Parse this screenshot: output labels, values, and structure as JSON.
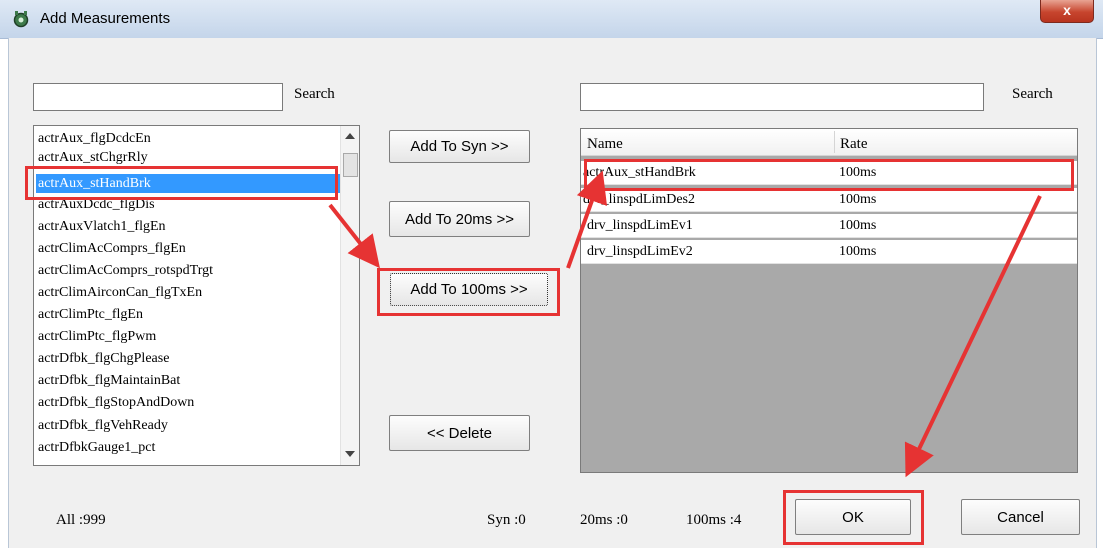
{
  "window": {
    "title": "Add Measurements",
    "close_glyph": "x",
    "icon": "app-gear-icon"
  },
  "left": {
    "search_value": "",
    "search_label": "Search",
    "items": [
      "actrAux_flgDcdcEn",
      "actrAux_stChgrRly",
      "actrAux_stHandBrk",
      "actrAuxDcdc_flgDis",
      "actrAuxVlatch1_flgEn",
      "actrClimAcComprs_flgEn",
      "actrClimAcComprs_rotspdTrgt",
      "actrClimAirconCan_flgTxEn",
      "actrClimPtc_flgEn",
      "actrClimPtc_flgPwm",
      "actrDfbk_flgChgPlease",
      "actrDfbk_flgMaintainBat",
      "actrDfbk_flgStopAndDown",
      "actrDfbk_flgVehReady",
      "actrDfbkGauge1_pct"
    ],
    "selected_index": 2
  },
  "buttons": {
    "add_syn": "Add To Syn >>",
    "add_20ms": "Add To 20ms >>",
    "add_100ms": "Add To 100ms >>",
    "delete": "<< Delete",
    "ok": "OK",
    "cancel": "Cancel"
  },
  "right": {
    "search_value": "",
    "search_label": "Search",
    "columns": [
      "Name",
      "Rate"
    ],
    "rows": [
      {
        "name": "actrAux_stHandBrk",
        "rate": "100ms"
      },
      {
        "name": "drv_linspdLimDes2",
        "rate": "100ms"
      },
      {
        "name": "drv_linspdLimEv1",
        "rate": "100ms"
      },
      {
        "name": "drv_linspdLimEv2",
        "rate": "100ms"
      }
    ]
  },
  "status": {
    "all": "All :999",
    "syn": "Syn :0",
    "ms20": "20ms :0",
    "ms100": "100ms :4"
  },
  "annotation_color": "#e63333",
  "selection_color": "#3399ff"
}
